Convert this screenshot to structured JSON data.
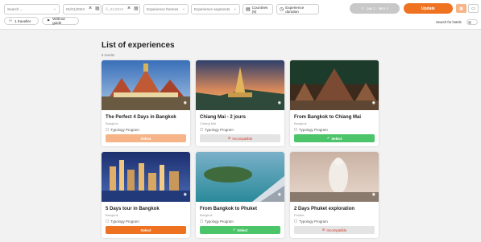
{
  "header": {
    "search_placeholder": "Search ...",
    "date_from": "01/01/2024",
    "date_to": "Å_01/2024",
    "experience_themes": "Experience themes",
    "experience_segments": "Experience segments",
    "countries": "Countries (5)",
    "experience_duration": "Experience duration",
    "pax_info": "pax 1 · item 4",
    "update_label": "Update",
    "traveller_label": "1 traveller",
    "guide_label": "Without guide",
    "hotels_label": "Search for hotels"
  },
  "main": {
    "title": "List of experiences",
    "results": "6 results"
  },
  "cards": [
    {
      "title": "The Perfect 4 Days in Bangkok",
      "city": "Bangkok",
      "typology": "Typology Program",
      "button": "Select"
    },
    {
      "title": "Chiang Mai - 2 jours",
      "city": "Chiang Mai",
      "typology": "Typology Program",
      "button": "Incompatible"
    },
    {
      "title": "From Bangkok to Chiang Mai",
      "city": "Bangkok",
      "typology": "Typology Program",
      "button": "Select"
    },
    {
      "title": "5 Days tour in Bangkok",
      "city": "Bangkok",
      "typology": "Typology Program",
      "button": "Select"
    },
    {
      "title": "From Bangkok to Phuket",
      "city": "Bangkok",
      "typology": "Typology Program",
      "button": "Select"
    },
    {
      "title": "2 Days Phuket exploration",
      "city": "Phuket",
      "typology": "Typology Program",
      "button": "Incompatible"
    }
  ],
  "colors": {
    "accent": "#ee7220",
    "success": "#4cc56a",
    "danger": "#d0392b"
  }
}
